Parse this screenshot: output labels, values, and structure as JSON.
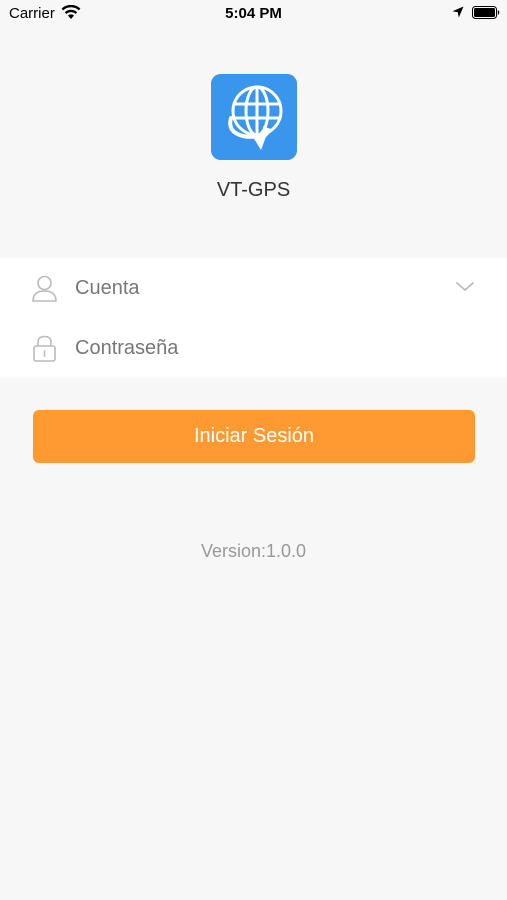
{
  "status_bar": {
    "carrier": "Carrier",
    "time": "5:04 PM",
    "wifi_icon": "wifi-icon",
    "location_icon": "location-arrow-icon",
    "battery_icon": "battery-icon"
  },
  "app": {
    "name": "VT-GPS",
    "logo_icon": "globe-location-logo",
    "logo_color": "#3a95ec"
  },
  "form": {
    "account_placeholder": "Cuenta",
    "password_placeholder": "Contraseña",
    "account_icon": "user-icon",
    "password_icon": "lock-icon",
    "dropdown_icon": "chevron-down-icon"
  },
  "login_button": {
    "label": "Iniciar Sesión",
    "color": "#ff9a33"
  },
  "version": "Version:1.0.0"
}
